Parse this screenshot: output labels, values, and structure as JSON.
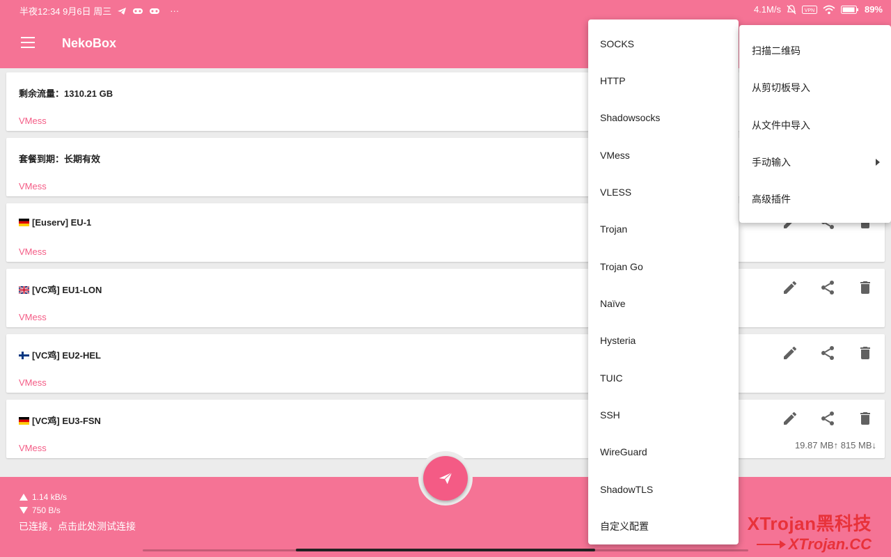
{
  "statusbar": {
    "time": "半夜12:34 9月6日 周三",
    "more": "···",
    "net_speed": "4.1M/s",
    "battery": "89"
  },
  "appbar": {
    "title": "NekoBox"
  },
  "cards": [
    {
      "title": "剩余流量：1310.21 GB",
      "type": "VMess"
    },
    {
      "title": "套餐到期：长期有效",
      "type": "VMess"
    },
    {
      "title": "[Euserv] EU-1",
      "type": "VMess",
      "flag": "de-flag-icon"
    },
    {
      "title": "[VC鸡] EU1-LON",
      "type": "VMess",
      "flag": "uk-flag-icon"
    },
    {
      "title": "[VC鸡] EU2-HEL",
      "type": "VMess",
      "flag": "fi-flag-icon"
    },
    {
      "title": "[VC鸡] EU3-FSN",
      "type": "VMess",
      "flag": "de-flag-icon",
      "traffic": "19.87 MB↑ 815 MB↓"
    }
  ],
  "bottombar": {
    "upload": "1.14 kB/s",
    "download": "750 B/s",
    "status": "已连接，点击此处测试连接"
  },
  "protocol_menu": {
    "items": [
      "SOCKS",
      "HTTP",
      "Shadowsocks",
      "VMess",
      "VLESS",
      "Trojan",
      "Trojan Go",
      "Naïve",
      "Hysteria",
      "TUIC",
      "SSH",
      "WireGuard",
      "ShadowTLS",
      "自定义配置"
    ]
  },
  "add_menu": {
    "items": [
      "扫描二维码",
      "从剪切板导入",
      "从文件中导入",
      "手动输入",
      "高级插件"
    ]
  },
  "watermark": {
    "title": "XTrojan黑科技",
    "url": "XTrojan.CC"
  },
  "colors": {
    "primary": "#f57395",
    "accent": "#f45b85",
    "watermark": "#e8323a"
  }
}
